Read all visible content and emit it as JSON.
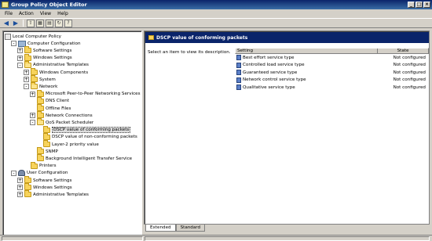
{
  "window": {
    "title": "Group Policy Object Editor",
    "controls": [
      "_",
      "□",
      "×"
    ]
  },
  "menu": [
    "File",
    "Action",
    "View",
    "Help"
  ],
  "toolbar": {
    "icons": [
      "back-icon",
      "forward-icon",
      "up-folder-icon",
      "show-hide-tree-icon",
      "properties-icon",
      "refresh-icon",
      "help-icon"
    ]
  },
  "tree": {
    "items": [
      {
        "label": "Local Computer Policy",
        "level": 0,
        "icon": "policy-icon",
        "expander": "",
        "open": true
      },
      {
        "label": "Computer Configuration",
        "level": 1,
        "icon": "computer-icon",
        "expander": "-",
        "open": true
      },
      {
        "label": "Software Settings",
        "level": 2,
        "icon": "folder-icon",
        "expander": "+"
      },
      {
        "label": "Windows Settings",
        "level": 2,
        "icon": "folder-icon",
        "expander": "+"
      },
      {
        "label": "Administrative Templates",
        "level": 2,
        "icon": "folder-icon",
        "expander": "-",
        "open": true
      },
      {
        "label": "Windows Components",
        "level": 3,
        "icon": "folder-icon",
        "expander": "+"
      },
      {
        "label": "System",
        "level": 3,
        "icon": "folder-icon",
        "expander": "+"
      },
      {
        "label": "Network",
        "level": 3,
        "icon": "folder-icon",
        "expander": "-",
        "open": true
      },
      {
        "label": "Microsoft Peer-to-Peer Networking Services",
        "level": 4,
        "icon": "folder-icon",
        "expander": "+"
      },
      {
        "label": "DNS Client",
        "level": 4,
        "icon": "folder-icon",
        "expander": ""
      },
      {
        "label": "Offline Files",
        "level": 4,
        "icon": "folder-icon",
        "expander": ""
      },
      {
        "label": "Network Connections",
        "level": 4,
        "icon": "folder-icon",
        "expander": "+"
      },
      {
        "label": "QoS Packet Scheduler",
        "level": 4,
        "icon": "folder-icon",
        "expander": "-",
        "open": true
      },
      {
        "label": "DSCP value of conforming packets",
        "level": 5,
        "icon": "folder-icon",
        "expander": "",
        "selected": true
      },
      {
        "label": "DSCP value of non-conforming packets",
        "level": 5,
        "icon": "folder-icon",
        "expander": ""
      },
      {
        "label": "Layer-2 priority value",
        "level": 5,
        "icon": "folder-icon",
        "expander": ""
      },
      {
        "label": "SNMP",
        "level": 4,
        "icon": "folder-icon",
        "expander": ""
      },
      {
        "label": "Background Intelligent Transfer Service",
        "level": 4,
        "icon": "folder-icon",
        "expander": ""
      },
      {
        "label": "Printers",
        "level": 3,
        "icon": "folder-icon",
        "expander": ""
      },
      {
        "label": "User Configuration",
        "level": 1,
        "icon": "user-icon",
        "expander": "-",
        "open": true
      },
      {
        "label": "Software Settings",
        "level": 2,
        "icon": "folder-icon",
        "expander": "+"
      },
      {
        "label": "Windows Settings",
        "level": 2,
        "icon": "folder-icon",
        "expander": "+"
      },
      {
        "label": "Administrative Templates",
        "level": 2,
        "icon": "folder-icon",
        "expander": "+"
      }
    ]
  },
  "details": {
    "header": "DSCP value of conforming packets",
    "description": "Select an item to view its description.",
    "columns": {
      "setting": "Setting",
      "state": "State"
    },
    "rows": [
      {
        "setting": "Best effort service type",
        "state": "Not configured"
      },
      {
        "setting": "Controlled load service type",
        "state": "Not configured"
      },
      {
        "setting": "Guaranteed service type",
        "state": "Not configured"
      },
      {
        "setting": "Network control service type",
        "state": "Not configured"
      },
      {
        "setting": "Qualitative service type",
        "state": "Not configured"
      }
    ]
  },
  "tabs": [
    {
      "label": "Extended",
      "active": true
    },
    {
      "label": "Standard",
      "active": false
    }
  ],
  "colors": {
    "title_bar": "#0a246a",
    "header_bar": "#0a246a",
    "window_bg": "#d4d0c8",
    "folder": "#f7d35b"
  }
}
